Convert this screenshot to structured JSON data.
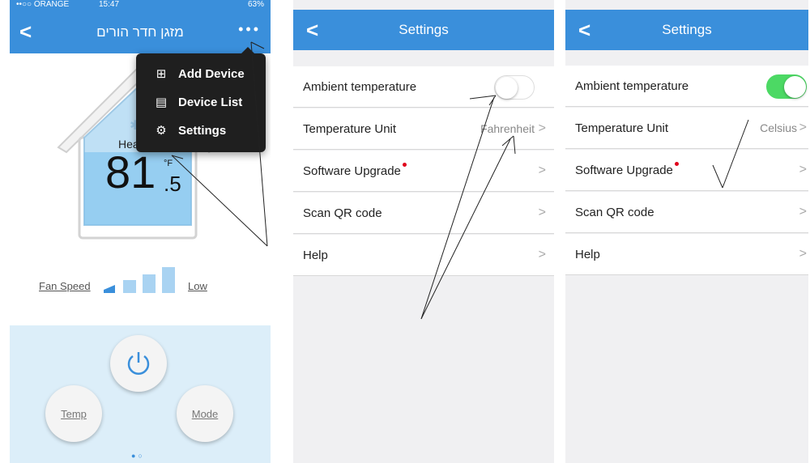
{
  "panel1": {
    "status": {
      "carrier": "••○○ ORANGE",
      "time": "15:47",
      "battery": "63%"
    },
    "title": "מזגן חדר הורים",
    "mode_label": "Hea",
    "temp_integer": "81",
    "temp_decimal": ".5",
    "temp_unit": "°F",
    "fan_speed_label": "Fan Speed",
    "fan_level": "Low",
    "buttons": {
      "temp": "Temp",
      "mode": "Mode"
    },
    "menu": [
      {
        "icon": "add-device-icon",
        "label": "Add Device"
      },
      {
        "icon": "device-list-icon",
        "label": "Device List"
      },
      {
        "icon": "gear-icon",
        "label": "Settings"
      }
    ]
  },
  "panel2": {
    "title": "Settings",
    "rows": [
      {
        "label": "Ambient temperature",
        "toggle": false
      },
      {
        "label": "Temperature Unit",
        "value": "Fahrenheit"
      },
      {
        "label": "Software Upgrade"
      },
      {
        "label": "Scan QR code"
      },
      {
        "label": "Help"
      }
    ]
  },
  "panel3": {
    "title": "Settings",
    "rows": [
      {
        "label": "Ambient temperature",
        "toggle": true
      },
      {
        "label": "Temperature Unit",
        "value": "Celsius"
      },
      {
        "label": "Software Upgrade"
      },
      {
        "label": "Scan QR code"
      },
      {
        "label": "Help"
      }
    ]
  },
  "colors": {
    "nav_blue": "#3a8fdb",
    "toggle_on": "#4cd964",
    "menu_bg": "#1f1f1f",
    "control_bg": "#dceef9"
  }
}
